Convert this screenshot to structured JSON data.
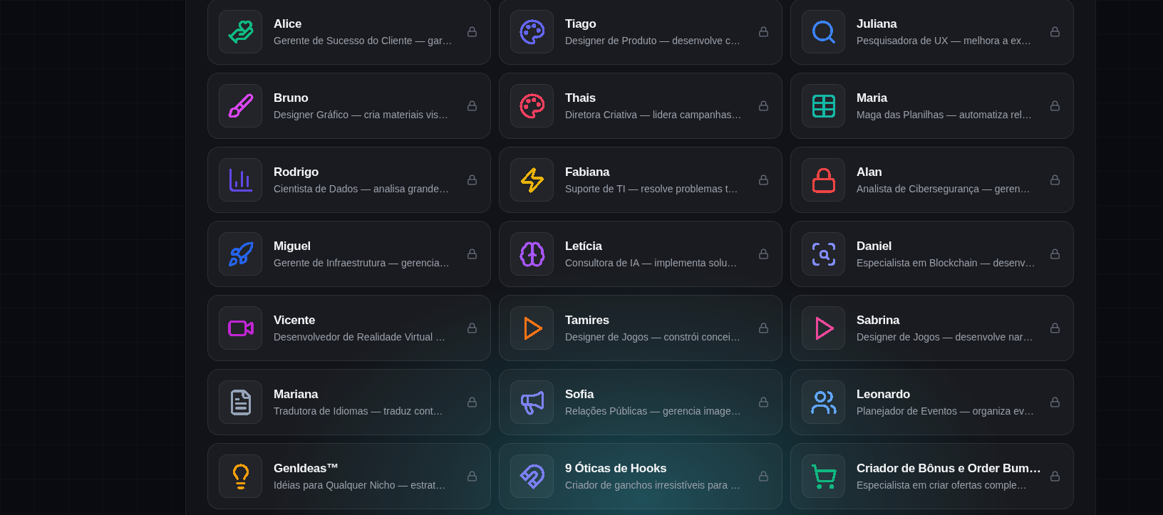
{
  "agents": [
    {
      "name": "Alice",
      "description": "Gerente de Sucesso do Cliente — gar…",
      "kind": "care",
      "color": "#10b981",
      "locked": true
    },
    {
      "name": "Tiago",
      "description": "Designer de Produto — desenvolve c…",
      "kind": "palette",
      "color": "#6366f1",
      "locked": true
    },
    {
      "name": "Juliana",
      "description": "Pesquisadora de UX — melhora a ex…",
      "kind": "search",
      "color": "#3b82f6",
      "locked": true
    },
    {
      "name": "Bruno",
      "description": "Designer Gráfico — cria materiais vis…",
      "kind": "brush",
      "color": "#d946ef",
      "locked": true
    },
    {
      "name": "Thais",
      "description": "Diretora Criativa — lidera campanhas…",
      "kind": "palette",
      "color": "#f43f5e",
      "locked": true
    },
    {
      "name": "Maria",
      "description": "Maga das Planilhas — automatiza rel…",
      "kind": "grid",
      "color": "#14b8a6",
      "locked": true
    },
    {
      "name": "Rodrigo",
      "description": "Cientista de Dados — analisa grande…",
      "kind": "chart",
      "color": "#6047e5",
      "locked": true
    },
    {
      "name": "Fabiana",
      "description": "Suporte de TI — resolve problemas t…",
      "kind": "bolt",
      "color": "#eab308",
      "locked": true
    },
    {
      "name": "Alan",
      "description": "Analista de Cibersegurança — geren…",
      "kind": "lock",
      "color": "#ef4444",
      "locked": true
    },
    {
      "name": "Miguel",
      "description": "Gerente de Infraestrutura — gerencia…",
      "kind": "rocket",
      "color": "#2563eb",
      "locked": true
    },
    {
      "name": "Letícia",
      "description": "Consultora de IA — implementa solu…",
      "kind": "brain",
      "color": "#a855f7",
      "locked": true
    },
    {
      "name": "Daniel",
      "description": "Especialista em Blockchain — desenv…",
      "kind": "scan",
      "color": "#818cf8",
      "locked": true
    },
    {
      "name": "Vicente",
      "description": "Desenvolvedor de Realidade Virtual …",
      "kind": "video",
      "color": "#c026d3",
      "locked": true
    },
    {
      "name": "Tamires",
      "description": "Designer de Jogos — constrói concei…",
      "kind": "play",
      "color": "#f97316",
      "locked": true
    },
    {
      "name": "Sabrina",
      "description": "Designer de Jogos — desenvolve nar…",
      "kind": "play",
      "color": "#ec4899",
      "locked": true
    },
    {
      "name": "Mariana",
      "description": "Tradutora de Idiomas — traduz cont…",
      "kind": "file",
      "color": "#94a3b8",
      "locked": true
    },
    {
      "name": "Sofia",
      "description": "Relações Públicas — gerencia image…",
      "kind": "megaphone",
      "color": "#7c83f0",
      "locked": true
    },
    {
      "name": "Leonardo",
      "description": "Planejador de Eventos — organiza ev…",
      "kind": "users",
      "color": "#60a5fa",
      "locked": true
    },
    {
      "name": "GenIdeas™",
      "description": "Idéias para Qualquer Nicho — estrat…",
      "kind": "bulb",
      "color": "#f59e0b",
      "locked": true
    },
    {
      "name": "9 Óticas de Hooks",
      "description": "Criador de ganchos irresistíveis para …",
      "kind": "magnet",
      "color": "#7b7ff2",
      "locked": true
    },
    {
      "name": "Criador de Bônus e Order Bum…",
      "description": "Especialista em criar ofertas comple…",
      "kind": "cart",
      "color": "#10b981",
      "locked": true
    }
  ]
}
